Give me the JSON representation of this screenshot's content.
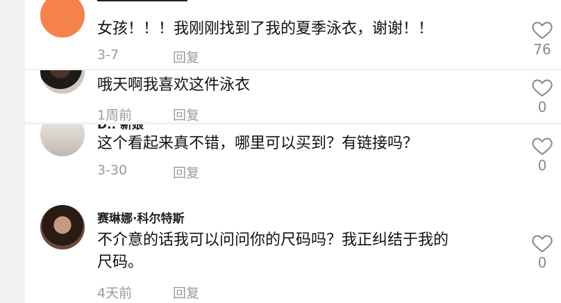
{
  "comments": [
    {
      "text": "女孩！！！我刚刚找到了我的夏季泳衣，谢谢！！",
      "date": "3-7",
      "reply": "回复",
      "likes": "76"
    },
    {
      "text": "哦天啊我喜欢这件泳衣",
      "date": "1周前",
      "reply": "回复",
      "likes": "0"
    },
    {
      "username": "D.. 新娘",
      "text": "这个看起来真不错，哪里可以买到？有链接吗？",
      "date": "3-30",
      "reply": "回复",
      "likes": "0"
    },
    {
      "username": "赛琳娜·科尔特斯",
      "text_line1": "不介意的话我可以问问你的尺码吗？我正纠结于我的",
      "text_line2": "尺码。",
      "date": "4天前",
      "reply": "回复",
      "likes": "0"
    }
  ],
  "icons": {
    "like": "heart-outline-icon"
  },
  "colors": {
    "avatar_orange": "#f5824a",
    "meta_gray": "#9a9a9a"
  }
}
